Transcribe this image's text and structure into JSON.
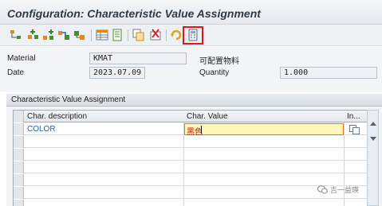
{
  "window": {
    "title": "Configuration: Characteristic Value Assignment"
  },
  "toolbar": {
    "buttons": [
      {
        "icon": "hierarchy-icon"
      },
      {
        "icon": "add-structure-icon"
      },
      {
        "icon": "add-node-icon"
      },
      {
        "icon": "move-node-icon"
      },
      {
        "icon": "node-settings-icon"
      },
      {
        "icon": "table-view-icon"
      },
      {
        "icon": "list-view-icon"
      },
      {
        "icon": "copy-values-icon"
      },
      {
        "icon": "delete-values-icon"
      },
      {
        "icon": "refresh-icon"
      },
      {
        "icon": "calculator-icon"
      }
    ],
    "highlight_color": "#e0151b"
  },
  "header": {
    "material_label": "Material",
    "material_value": "KMAT",
    "material_desc": "可配置物料",
    "date_label": "Date",
    "date_value": "2023.07.09",
    "quantity_label": "Quantity",
    "quantity_value": "1.000"
  },
  "group": {
    "title": "Characteristic Value Assignment"
  },
  "table": {
    "columns": [
      "Char. description",
      "Char. Value",
      "In..."
    ],
    "rows": [
      {
        "description": "COLOR",
        "value": "黑色"
      }
    ]
  },
  "watermark": {
    "text": "吉一益瑛"
  }
}
